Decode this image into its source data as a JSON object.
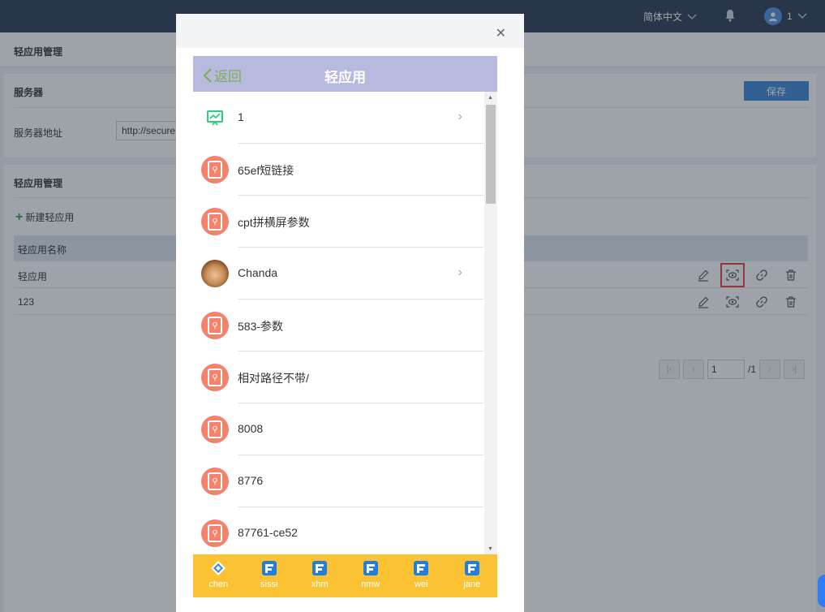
{
  "header": {
    "language": "简体中文",
    "user_name": "1"
  },
  "breadcrumb": "轻应用管理",
  "server": {
    "title": "服务器",
    "save_label": "保存",
    "address_label": "服务器地址",
    "address_value": "http://secure"
  },
  "app_mgmt": {
    "title": "轻应用管理",
    "new_label": "新建轻应用",
    "column_name": "轻应用名称",
    "rows": [
      {
        "name": "轻应用"
      },
      {
        "name": "123"
      }
    ],
    "pager": {
      "current": "1",
      "total": "/1"
    }
  },
  "modal": {
    "back_label": "返回",
    "title": "轻应用",
    "items": [
      {
        "label": "1",
        "icon": "chart-icon",
        "has_arrow": true
      },
      {
        "label": "65ef短链接",
        "icon": "link-icon",
        "has_arrow": false
      },
      {
        "label": "cpt拼横屏参数",
        "icon": "link-icon",
        "has_arrow": false
      },
      {
        "label": "Chanda",
        "icon": "photo-avatar",
        "has_arrow": true
      },
      {
        "label": "583-参数",
        "icon": "link-icon",
        "has_arrow": false
      },
      {
        "label": "相对路径不带/",
        "icon": "link-icon",
        "has_arrow": false
      },
      {
        "label": "8008",
        "icon": "link-icon",
        "has_arrow": false
      },
      {
        "label": "8776",
        "icon": "link-icon",
        "has_arrow": false
      },
      {
        "label": "87761-ce52",
        "icon": "link-icon",
        "has_arrow": false
      }
    ],
    "tabs": [
      {
        "label": "chen",
        "active": true
      },
      {
        "label": "sissi",
        "active": false
      },
      {
        "label": "xhm",
        "active": false
      },
      {
        "label": "nmw",
        "active": false
      },
      {
        "label": "wei",
        "active": false
      },
      {
        "label": "jane",
        "active": false
      }
    ]
  },
  "colors": {
    "topbar": "#2b3a52",
    "accent": "#3d86d8",
    "phone_header": "#b7b9de",
    "tabbar": "#fbc234",
    "link_icon": "#f5826a",
    "highlight": "#e23b3b"
  }
}
